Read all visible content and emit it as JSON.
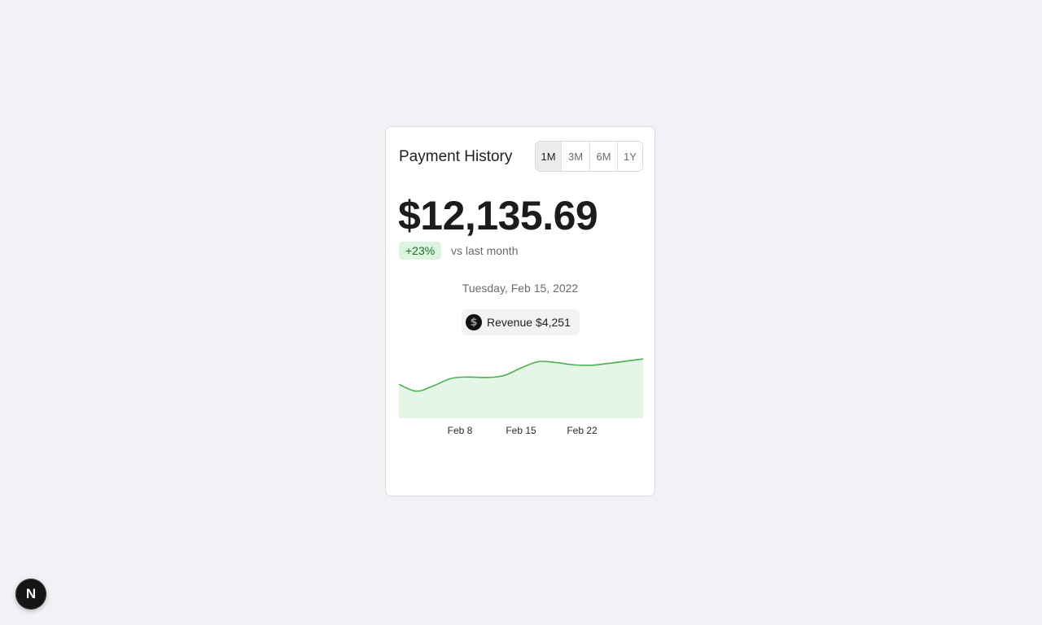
{
  "card": {
    "title": "Payment History",
    "ranges": [
      {
        "label": "1M",
        "active": true
      },
      {
        "label": "3M",
        "active": false
      },
      {
        "label": "6M",
        "active": false
      },
      {
        "label": "1Y",
        "active": false
      }
    ],
    "amount": "$12,135.69",
    "change": "+23%",
    "change_caption": "vs last month",
    "selected_date": "Tuesday, Feb 15, 2022",
    "revenue_label": "Revenue",
    "revenue_value": "$4,251"
  },
  "chart_data": {
    "type": "area",
    "x": [
      "Feb 1",
      "Feb 3",
      "Feb 5",
      "Feb 7",
      "Feb 9",
      "Feb 11",
      "Feb 13",
      "Feb 15",
      "Feb 17",
      "Feb 19",
      "Feb 21",
      "Feb 23",
      "Feb 25",
      "Feb 27",
      "Mar 1"
    ],
    "values": [
      3450,
      3300,
      3420,
      3580,
      3610,
      3600,
      3640,
      3810,
      3950,
      3930,
      3880,
      3870,
      3910,
      3960,
      4010
    ],
    "x_tick_labels": [
      "Feb 8",
      "Feb 15",
      "Feb 22"
    ],
    "ylim": [
      2700,
      4100
    ],
    "line_color": "#4caf50",
    "fill_color": "#e4f6e6",
    "grid": false
  },
  "icons": {
    "revenue_icon": "dollar-circle-icon",
    "framework_badge": "N"
  },
  "colors": {
    "background": "#f2f2f6",
    "badge_bg": "#dcf5df",
    "badge_text": "#1f6b2a",
    "accent_green": "#4caf50"
  }
}
